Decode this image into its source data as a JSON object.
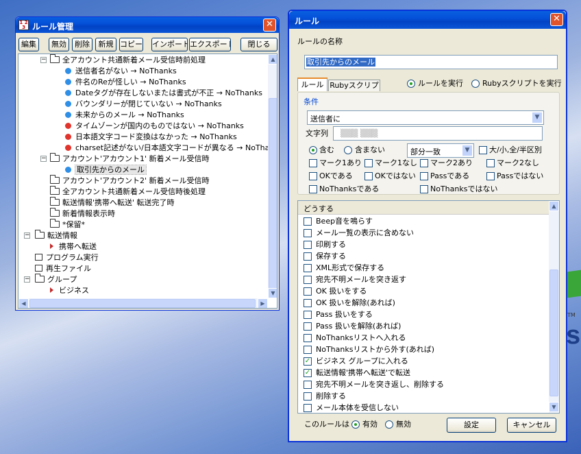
{
  "bg": {
    "logo_text": "s",
    "tm": "TM"
  },
  "rm": {
    "title": "ルール管理",
    "app_icon": "app-icon",
    "close": "✕",
    "toolbar": [
      "編集",
      "無効",
      "削除",
      "新規",
      "コピー",
      "インポート",
      "エクスポート",
      "閉じる"
    ],
    "tree": [
      {
        "text": "全アカウント共通新着メール受信時前処理",
        "kind": "folder-open",
        "exp": "−"
      },
      {
        "text": "送信者名がない → NoThanks",
        "kind": "blue"
      },
      {
        "text": "件名のReが怪しい → NoThanks",
        "kind": "blue"
      },
      {
        "text": "Dateタグが存在しないまたは書式が不正 → NoThanks",
        "kind": "blue"
      },
      {
        "text": "バウンダリーが閉じていない → NoThanks",
        "kind": "blue"
      },
      {
        "text": "未来からのメール → NoThanks",
        "kind": "blue"
      },
      {
        "text": "タイムゾーンが国内のものではない → NoThanks",
        "kind": "red"
      },
      {
        "text": "日本語文字コード変換はなかった → NoThanks",
        "kind": "red"
      },
      {
        "text": "charset記述がない/日本語文字コードが異なる → NoThanks",
        "kind": "red"
      },
      {
        "text": "アカウント'アカウント1' 新着メール受信時",
        "kind": "folder-open",
        "exp": "−"
      },
      {
        "text": "取引先からのメール",
        "kind": "blue",
        "selected": true
      },
      {
        "text": "アカウント'アカウント2' 新着メール受信時",
        "kind": "folder"
      },
      {
        "text": "全アカウント共通新着メール受信時後処理",
        "kind": "folder"
      },
      {
        "text": "転送情報'携帯へ転送' 転送完了時",
        "kind": "folder"
      },
      {
        "text": "新着情報表示時",
        "kind": "folder"
      },
      {
        "text": "*保留*",
        "kind": "folder"
      },
      {
        "text": "転送情報",
        "kind": "folder-open",
        "exp": "−"
      },
      {
        "text": "携帯へ転送",
        "kind": "arrow"
      },
      {
        "text": "プログラム実行",
        "kind": "square"
      },
      {
        "text": "再生ファイル",
        "kind": "square"
      },
      {
        "text": "グループ",
        "kind": "folder-open",
        "exp": "−"
      },
      {
        "text": "ビジネス",
        "kind": "arrow"
      }
    ]
  },
  "rule": {
    "title": "ルール",
    "close": "✕",
    "name_label": "ルールの名称",
    "name_value": "取引先からのメール",
    "tab1": "ルール",
    "tab2": "Rubyスクリプト",
    "radio_rule": "ルールを実行",
    "radio_ruby": "Rubyスクリプトを実行",
    "cond_title": "条件",
    "sender_select": "送信者に",
    "string_label": "文字列",
    "string_value": "▒▒▒ ▒▒▒",
    "contains": "含む",
    "not_contains": "含まない",
    "match_select": "部分一致",
    "case": "大/小,全/半区別",
    "flags": [
      "マーク1あり",
      "マーク1なし",
      "マーク2あり",
      "マーク2なし",
      "OKである",
      "OKではない",
      "Passである",
      "Passではない",
      "NoThanksである",
      "NoThanksではない"
    ],
    "actions_title": "どうする",
    "actions": [
      {
        "text": "Beep音を鳴らす",
        "checked": false
      },
      {
        "text": "メール一覧の表示に含めない",
        "checked": false
      },
      {
        "text": "印刷する",
        "checked": false
      },
      {
        "text": "保存する",
        "checked": false
      },
      {
        "text": "XML形式で保存する",
        "checked": false
      },
      {
        "text": "宛先不明メールを突き返す",
        "checked": false
      },
      {
        "text": "OK 扱いをする",
        "checked": false
      },
      {
        "text": "OK 扱いを解除(あれば)",
        "checked": false
      },
      {
        "text": "Pass 扱いをする",
        "checked": false
      },
      {
        "text": "Pass 扱いを解除(あれば)",
        "checked": false
      },
      {
        "text": "NoThanksリストへ入れる",
        "checked": false
      },
      {
        "text": "NoThanksリストから外す(あれば)",
        "checked": false
      },
      {
        "text": "ビジネス グループに入れる",
        "checked": true
      },
      {
        "text": "転送情報'携帯へ転送'で転送",
        "checked": true
      },
      {
        "text": "宛先不明メールを突き返し、削除する",
        "checked": false
      },
      {
        "text": "削除する",
        "checked": false
      },
      {
        "text": "メール本体を受信しない",
        "checked": false
      }
    ],
    "this_rule": "このルールは",
    "enabled": "有効",
    "disabled": "無効",
    "ok": "設定",
    "cancel": "キャンセル"
  },
  "colors": {
    "xp_title": "#0451d8",
    "selection": "#316ac5",
    "bullet_blue": "#2f8fe6",
    "bullet_red": "#e0342c",
    "check_green": "#21a121"
  }
}
